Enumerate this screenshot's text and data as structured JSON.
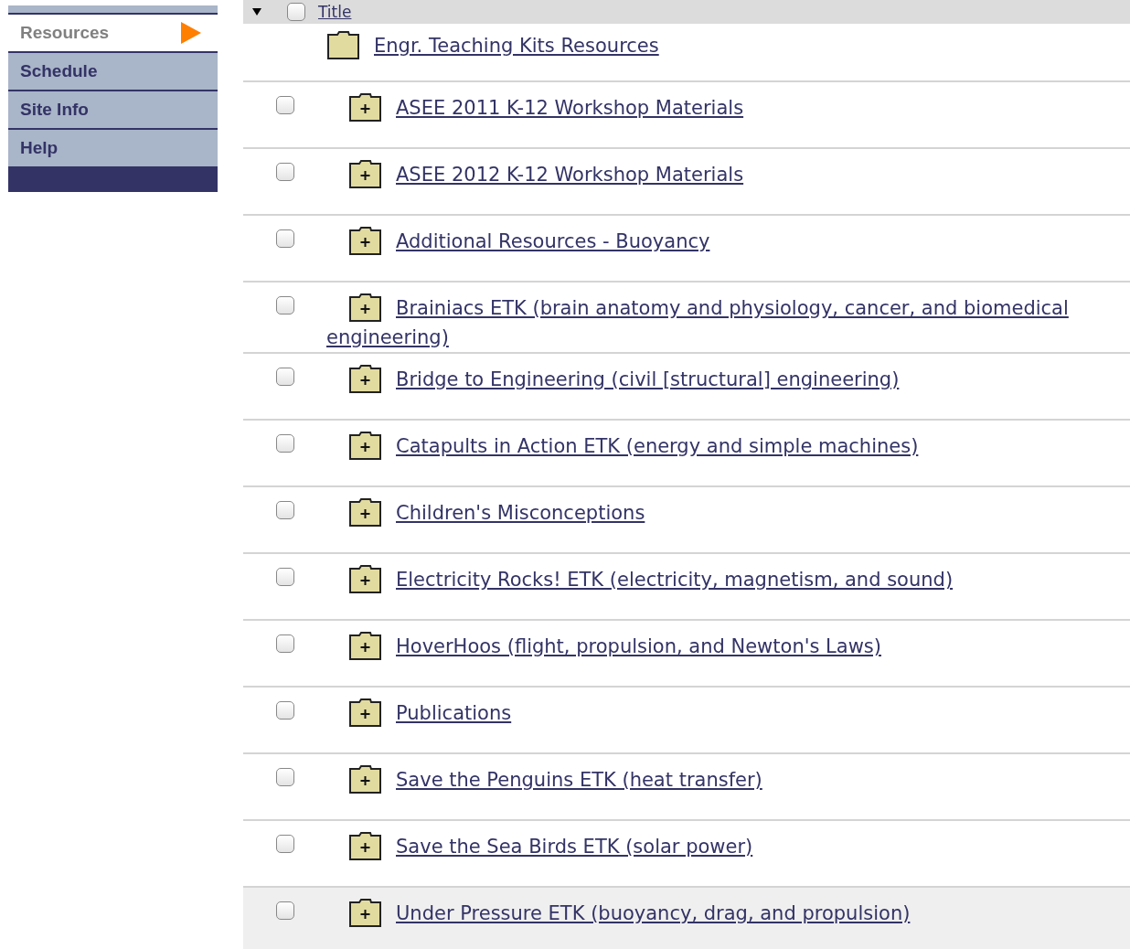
{
  "sidebar": {
    "items": [
      {
        "label": "Resources",
        "selected": true
      },
      {
        "label": "Schedule",
        "selected": false
      },
      {
        "label": "Site Info",
        "selected": false
      },
      {
        "label": "Help",
        "selected": false
      }
    ]
  },
  "table": {
    "header": {
      "label": "Title",
      "checked": false
    },
    "root": {
      "title": "Engr. Teaching Kits Resources"
    },
    "rows": [
      {
        "title": "ASEE 2011 K-12 Workshop Materials",
        "checked": false,
        "highlighted": false
      },
      {
        "title": "ASEE 2012 K-12 Workshop Materials",
        "checked": false,
        "highlighted": false
      },
      {
        "title": "Additional Resources - Buoyancy",
        "checked": false,
        "highlighted": false
      },
      {
        "title": "Brainiacs ETK (brain anatomy and physiology, cancer, and biomedical engineering)",
        "checked": false,
        "highlighted": false
      },
      {
        "title": "Bridge to Engineering (civil [structural] engineering)",
        "checked": false,
        "highlighted": false
      },
      {
        "title": "Catapults in Action ETK (energy and simple machines)",
        "checked": false,
        "highlighted": false
      },
      {
        "title": "Children's Misconceptions",
        "checked": false,
        "highlighted": false
      },
      {
        "title": "Electricity Rocks! ETK (electricity, magnetism, and sound)",
        "checked": false,
        "highlighted": false
      },
      {
        "title": "HoverHoos (flight, propulsion, and Newton's Laws)",
        "checked": false,
        "highlighted": false
      },
      {
        "title": "Publications",
        "checked": false,
        "highlighted": false
      },
      {
        "title": "Save the Penguins ETK (heat transfer)",
        "checked": false,
        "highlighted": false
      },
      {
        "title": "Save the Sea Birds ETK (solar power)",
        "checked": false,
        "highlighted": false
      },
      {
        "title": "Under Pressure ETK (buoyancy, drag, and propulsion)",
        "checked": false,
        "highlighted": true
      }
    ]
  }
}
